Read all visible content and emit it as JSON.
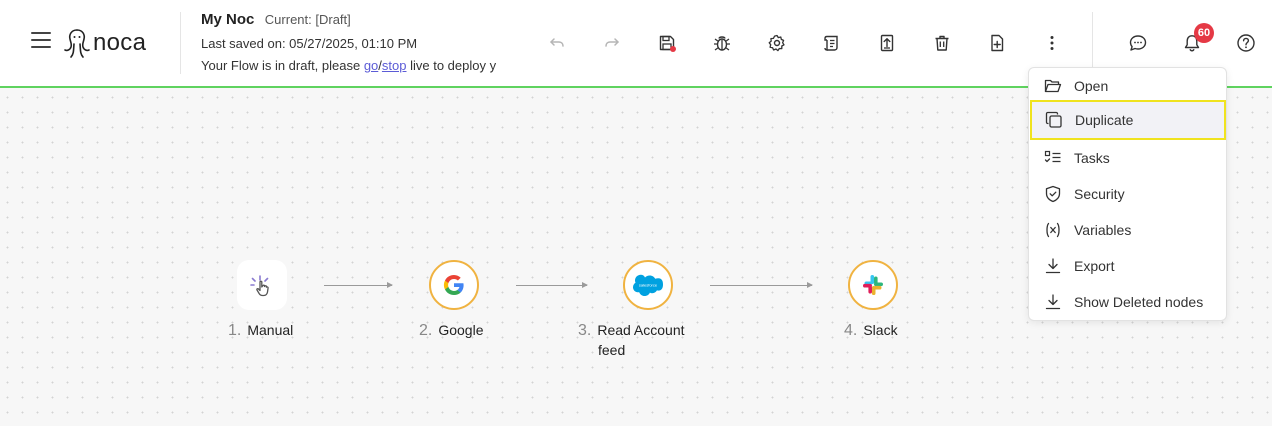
{
  "header": {
    "logo_text": "noca",
    "flow_name": "My Noc",
    "flow_state": "Current: [Draft]",
    "last_saved": "Last saved on: 05/27/2025, 01:10 PM",
    "draft_prefix": "Your Flow is in draft, please ",
    "draft_go": "go",
    "draft_sep": "/",
    "draft_stop": "stop",
    "draft_suffix": " live to deploy y"
  },
  "toolbar": {
    "icons": [
      "undo-icon",
      "redo-icon",
      "save-icon",
      "debug-icon",
      "settings-icon",
      "logs-icon",
      "upload-icon",
      "delete-icon",
      "new-file-icon",
      "more-icon",
      "chat-icon",
      "bell-icon",
      "help-icon"
    ],
    "save_dot_color": "#e53945",
    "notifications_count": "60"
  },
  "nodes": [
    {
      "num": "1.",
      "label": "Manual",
      "icon": "manual-trigger-icon"
    },
    {
      "num": "2.",
      "label": "Google",
      "icon": "google-icon"
    },
    {
      "num": "3.",
      "label": "Read Account feed",
      "label_line1": "Read Account",
      "label_line2": "feed",
      "icon": "salesforce-icon"
    },
    {
      "num": "4.",
      "label": "Slack",
      "icon": "slack-icon"
    }
  ],
  "menu": {
    "items": [
      {
        "label": "Open",
        "icon": "folder-open-icon"
      },
      {
        "label": "Duplicate",
        "icon": "duplicate-icon",
        "highlighted": true
      },
      {
        "label": "Tasks",
        "icon": "tasks-icon"
      },
      {
        "label": "Security",
        "icon": "shield-icon"
      },
      {
        "label": "Variables",
        "icon": "variables-icon"
      },
      {
        "label": "Export",
        "icon": "export-icon"
      },
      {
        "label": "Show Deleted nodes",
        "icon": "download-icon"
      }
    ]
  },
  "colors": {
    "header_border": "#5fd35f",
    "node_ring": "#f0b341",
    "highlight_border": "#f0e31e",
    "link": "#5b5bd6",
    "badge": "#e53945"
  }
}
